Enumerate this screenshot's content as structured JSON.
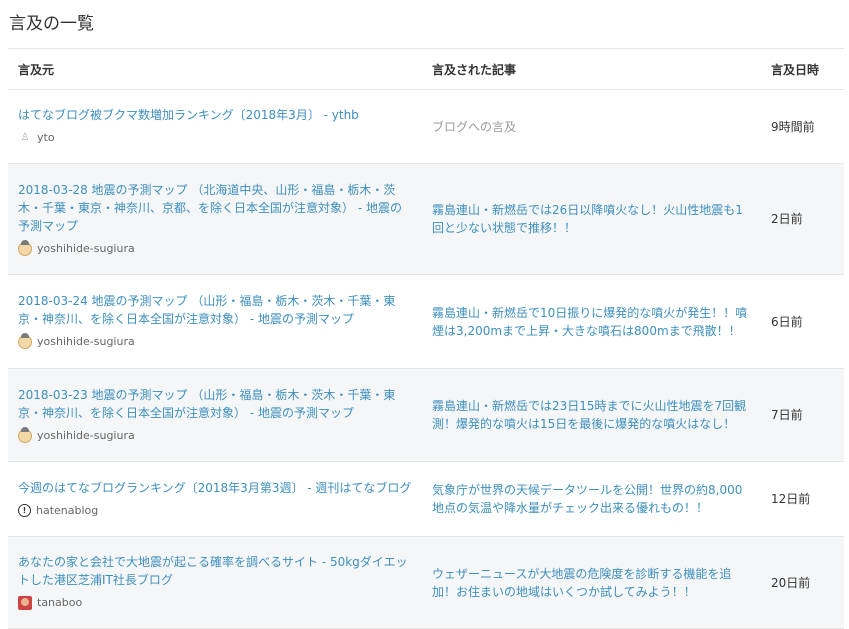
{
  "page": {
    "title": "言及の一覧"
  },
  "table": {
    "headers": {
      "source": "言及元",
      "article": "言及された記事",
      "datetime": "言及日時"
    },
    "rows": [
      {
        "source_title": "はてなブログ被ブクマ数増加ランキング〔2018年3月〕 - ythb",
        "user": "yto",
        "user_icon": "small-icon",
        "article": "ブログへの言及",
        "article_style": "gray",
        "time": "9時間前"
      },
      {
        "source_title": "2018-03-28 地震の予測マップ （北海道中央、山形・福島・栃木・茨木・千葉・東京・神奈川、京都、を除く日本全国が注意対象） - 地震の予測マップ",
        "user": "yoshihide-sugiura",
        "user_icon": "avatar-icon",
        "article": "霧島連山・新燃岳では26日以降噴火なし！火山性地震も1回と少ない状態で推移！！",
        "article_style": "link",
        "time": "2日前"
      },
      {
        "source_title": "2018-03-24 地震の予測マップ （山形・福島・栃木・茨木・千葉・東京・神奈川、を除く日本全国が注意対象） - 地震の予測マップ",
        "user": "yoshihide-sugiura",
        "user_icon": "avatar-icon",
        "article": "霧島連山・新燃岳で10日振りに爆発的な噴火が発生！！噴煙は3,200mまで上昇・大きな噴石は800mまで飛散！！",
        "article_style": "link",
        "time": "6日前"
      },
      {
        "source_title": "2018-03-23 地震の予測マップ （山形・福島・栃木・茨木・千葉・東京・神奈川、を除く日本全国が注意対象） - 地震の予測マップ",
        "user": "yoshihide-sugiura",
        "user_icon": "avatar-icon",
        "article": "霧島連山・新燃岳では23日15時までに火山性地震を7回観測！爆発的な噴火は15日を最後に爆発的な噴火はなし！",
        "article_style": "link",
        "time": "7日前"
      },
      {
        "source_title": "今週のはてなブログランキング〔2018年3月第3週〕 - 週刊はてなブログ",
        "user": "hatenablog",
        "user_icon": "hatena-icon",
        "article": "気象庁が世界の天候データツールを公開！世界の約8,000地点の気温や降水量がチェック出来る優れもの！！",
        "article_style": "link",
        "time": "12日前"
      },
      {
        "source_title": "あなたの家と会社で大地震が起こる確率を調べるサイト - 50kgダイエットした港区芝浦IT社長ブログ",
        "user": "tanaboo",
        "user_icon": "person-icon",
        "article": "ウェザーニュースが大地震の危険度を診断する機能を追加！お住まいの地域はいくつか試してみよう！！",
        "article_style": "link",
        "time": "20日前"
      }
    ]
  }
}
